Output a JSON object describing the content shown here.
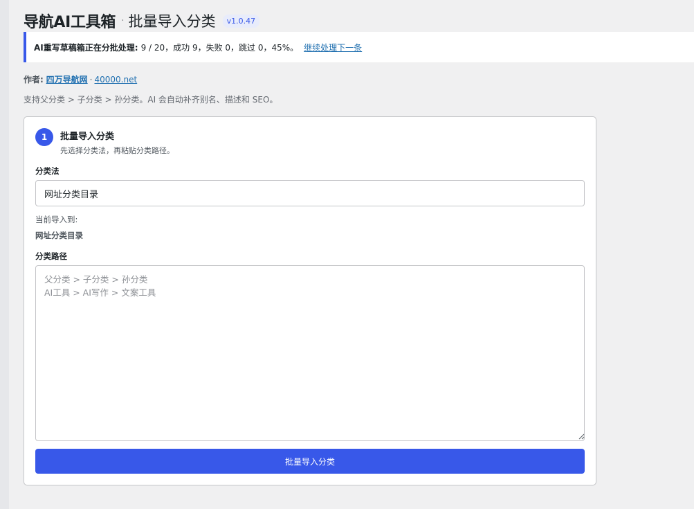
{
  "header": {
    "brand": "导航AI工具箱",
    "separator": "·",
    "page_title": "批量导入分类",
    "version": "v1.0.47"
  },
  "notice": {
    "label": "AI重写草稿箱正在分批处理:",
    "status": "9 / 20，成功 9，失败 0，跳过 0，45%。",
    "link": "继续处理下一条"
  },
  "author": {
    "label": "作者:",
    "name": "四万导航网",
    "dot": "·",
    "site": "40000.net"
  },
  "description": "支持父分类 > 子分类 > 孙分类。AI 会自动补齐别名、描述和 SEO。",
  "card": {
    "step_number": "1",
    "step_title": "批量导入分类",
    "step_subtitle": "先选择分类法，再粘贴分类路径。",
    "taxonomy_label": "分类法",
    "taxonomy_value": "网址分类目录",
    "current_label": "当前导入到:",
    "current_value": "网址分类目录",
    "path_label": "分类路径",
    "path_placeholder": "父分类 > 子分类 > 孙分类\nAI工具 > AI写作 > 文案工具",
    "submit_label": "批量导入分类"
  },
  "colors": {
    "accent": "#3858e9",
    "link": "#2271b1",
    "background": "#f0f0f1"
  }
}
